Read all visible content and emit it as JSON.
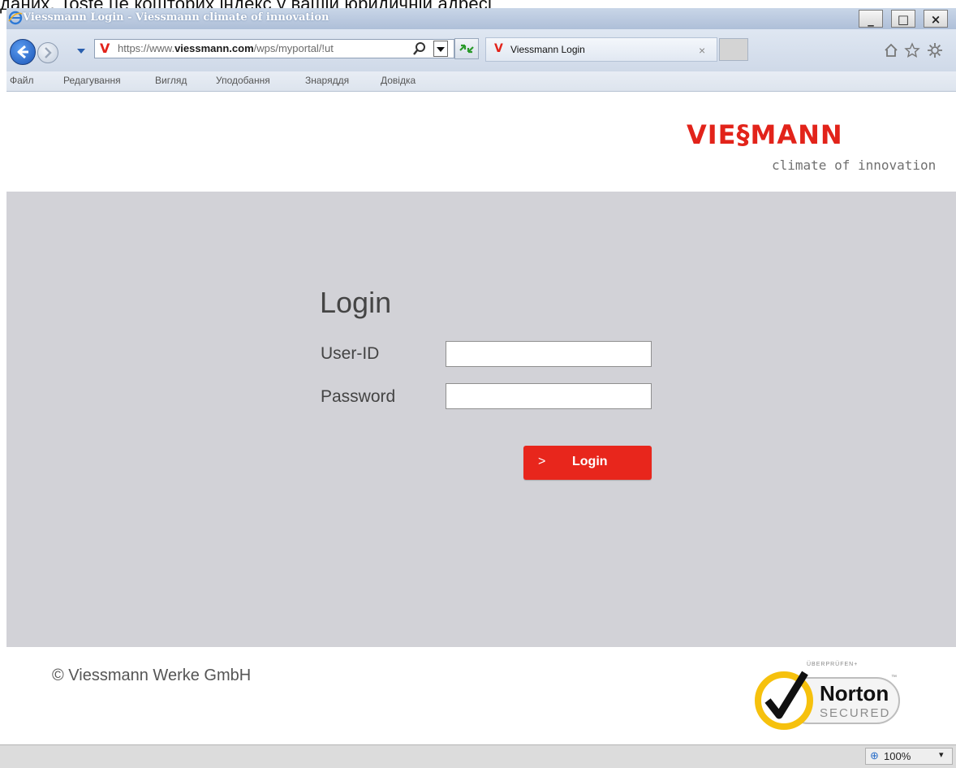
{
  "caption": {
    "text": "даних. Toste це кошторих індекс у вашій юридичній адресі"
  },
  "window": {
    "title": "Viessmann Login - Viessmann climate of innovation",
    "min": "_",
    "max": "□",
    "close": "×"
  },
  "address": {
    "url_prefix": "https://www.",
    "url_domain": "viessmann.com",
    "url_path": "/wps/myportal/!ut"
  },
  "tab": {
    "title": "Viessmann Login",
    "close": "×"
  },
  "menu": {
    "items": [
      "Файл",
      "Редагування",
      "Вигляд",
      "Уподобання",
      "Знаряддя",
      "Довідка"
    ]
  },
  "brand": {
    "logo": "VIE§MANN",
    "tagline": "climate of innovation"
  },
  "login": {
    "title": "Login",
    "user_label": "User-ID",
    "user_value": "",
    "password_label": "Password",
    "password_value": "",
    "button_label": "Login",
    "button_arrow": ">"
  },
  "footer": {
    "copyright": "© Viessmann Werke GmbH"
  },
  "norton": {
    "top_text": "ÜBERPRÜFEN+",
    "name": "Norton",
    "secured": "SECURED",
    "tm": "™"
  },
  "status": {
    "zoom": "100%"
  },
  "colors": {
    "brand_red": "#e2231a",
    "panel_gray": "#d2d2d7"
  }
}
